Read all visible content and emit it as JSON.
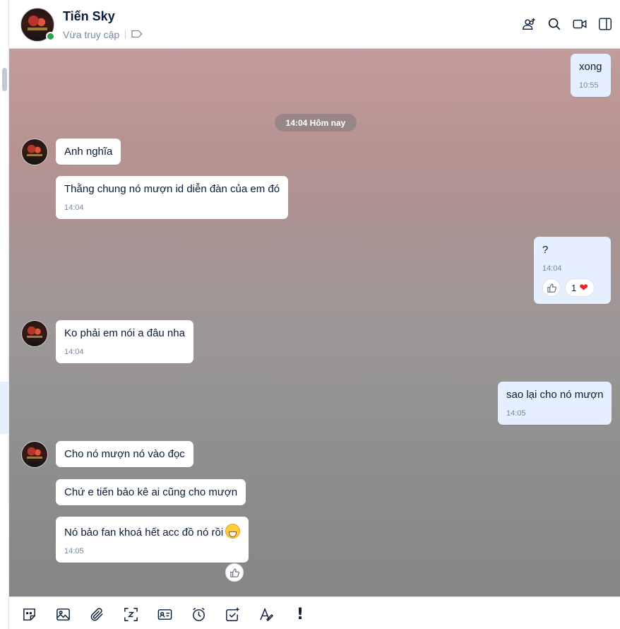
{
  "header": {
    "name": "Tiến Sky",
    "status": "Vừa truy cập",
    "icons": [
      "add-member-icon",
      "search-icon",
      "video-call-icon",
      "sidebar-toggle-icon"
    ]
  },
  "date_divider": "14:04 Hôm nay",
  "messages": {
    "m1": {
      "text": "xong",
      "time": "10:55"
    },
    "m2": {
      "text": "Anh nghĩa"
    },
    "m3": {
      "text": "Thằng chung nó mượn id diễn đàn của em đó",
      "time": "14:04"
    },
    "m4": {
      "text": "?",
      "time": "14:04",
      "reaction_count": "1"
    },
    "m5": {
      "text": "Ko phải em nói a đâu nha",
      "time": "14:04"
    },
    "m6": {
      "text": "sao lại cho nó mượn",
      "time": "14:05"
    },
    "m7": {
      "text": "Cho nó mượn nó vào đọc"
    },
    "m8": {
      "text": "Chứ e tiến bảo kê ai cũng cho mượn"
    },
    "m9": {
      "text": "Nó bảo fan khoá hết acc đồ nó rồi",
      "time": "14:05"
    }
  },
  "toolbar": {
    "icons": [
      "sticker-icon",
      "image-icon",
      "attachment-icon",
      "screenshot-icon",
      "contact-card-icon",
      "reminder-icon",
      "task-icon",
      "text-format-icon",
      "urgent-icon"
    ],
    "urgent_label": "!"
  },
  "colors": {
    "bubble_mine": "#e5efff",
    "bubble_theirs": "#ffffff",
    "online": "#30a24c",
    "heart": "#e5252a"
  }
}
